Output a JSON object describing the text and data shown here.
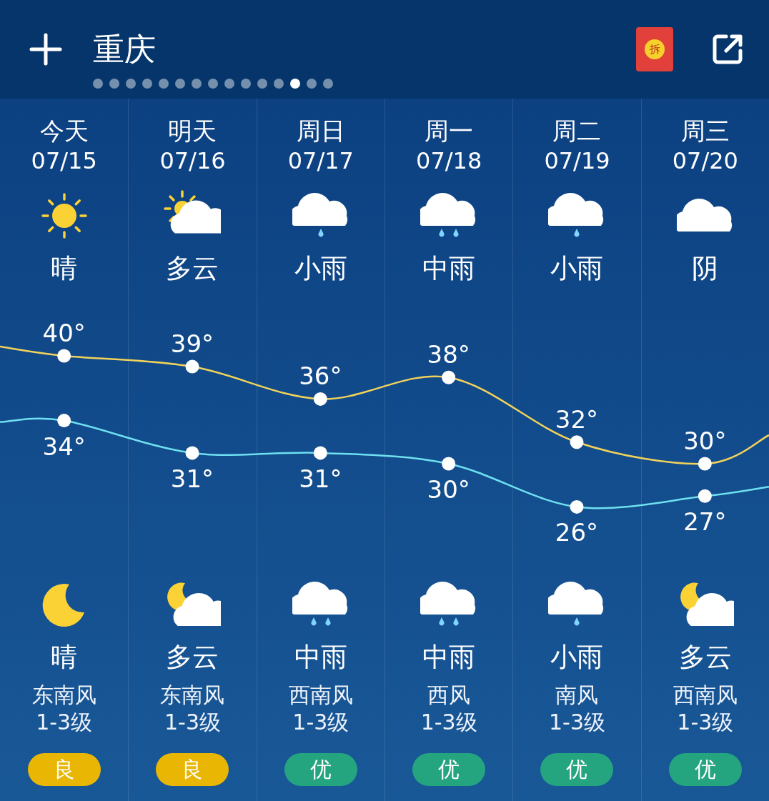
{
  "header": {
    "city": "重庆",
    "red_packet": "拆",
    "pages": [
      {
        "selected": false
      },
      {
        "selected": false
      },
      {
        "selected": false
      },
      {
        "selected": false
      },
      {
        "selected": false
      },
      {
        "selected": false
      },
      {
        "selected": false
      },
      {
        "selected": false
      },
      {
        "selected": false
      },
      {
        "selected": false
      },
      {
        "selected": false
      },
      {
        "selected": false
      },
      {
        "selected": true
      },
      {
        "selected": false
      },
      {
        "selected": false
      }
    ]
  },
  "days": [
    {
      "day": "今天",
      "date": "07/15",
      "daytime": {
        "kind": "sunny",
        "text": "晴"
      },
      "high": "40°",
      "low": "34°",
      "night": {
        "kind": "clear_night",
        "text": "晴"
      },
      "wind": "东南风",
      "wind_level": "1-3级",
      "aqi": "良",
      "color": "#e9b703"
    },
    {
      "day": "明天",
      "date": "07/16",
      "daytime": {
        "kind": "partly_cloudy",
        "text": "多云"
      },
      "high": "39°",
      "low": "31°",
      "night": {
        "kind": "cloudy_night",
        "text": "多云"
      },
      "wind": "东南风",
      "wind_level": "1-3级",
      "aqi": "良",
      "color": "#e9b703"
    },
    {
      "day": "周日",
      "date": "07/17",
      "daytime": {
        "kind": "light_rain",
        "text": "小雨"
      },
      "high": "36°",
      "low": "31°",
      "night": {
        "kind": "moderate_rain",
        "text": "中雨"
      },
      "wind": "西南风",
      "wind_level": "1-3级",
      "aqi": "优",
      "color": "#24a57f"
    },
    {
      "day": "周一",
      "date": "07/18",
      "daytime": {
        "kind": "moderate_rain",
        "text": "中雨"
      },
      "high": "38°",
      "low": "30°",
      "night": {
        "kind": "moderate_rain",
        "text": "中雨"
      },
      "wind": "西风",
      "wind_level": "1-3级",
      "aqi": "优",
      "color": "#24a57f"
    },
    {
      "day": "周二",
      "date": "07/19",
      "daytime": {
        "kind": "light_rain",
        "text": "小雨"
      },
      "high": "32°",
      "low": "26°",
      "night": {
        "kind": "light_rain",
        "text": "小雨"
      },
      "wind": "南风",
      "wind_level": "1-3级",
      "aqi": "优",
      "color": "#24a57f"
    },
    {
      "day": "周三",
      "date": "07/20",
      "daytime": {
        "kind": "overcast",
        "text": "阴"
      },
      "high": "30°",
      "low": "27°",
      "night": {
        "kind": "cloudy_night",
        "text": "多云"
      },
      "wind": "西南风",
      "wind_level": "1-3级",
      "aqi": "优",
      "color": "#24a57f"
    }
  ]
}
